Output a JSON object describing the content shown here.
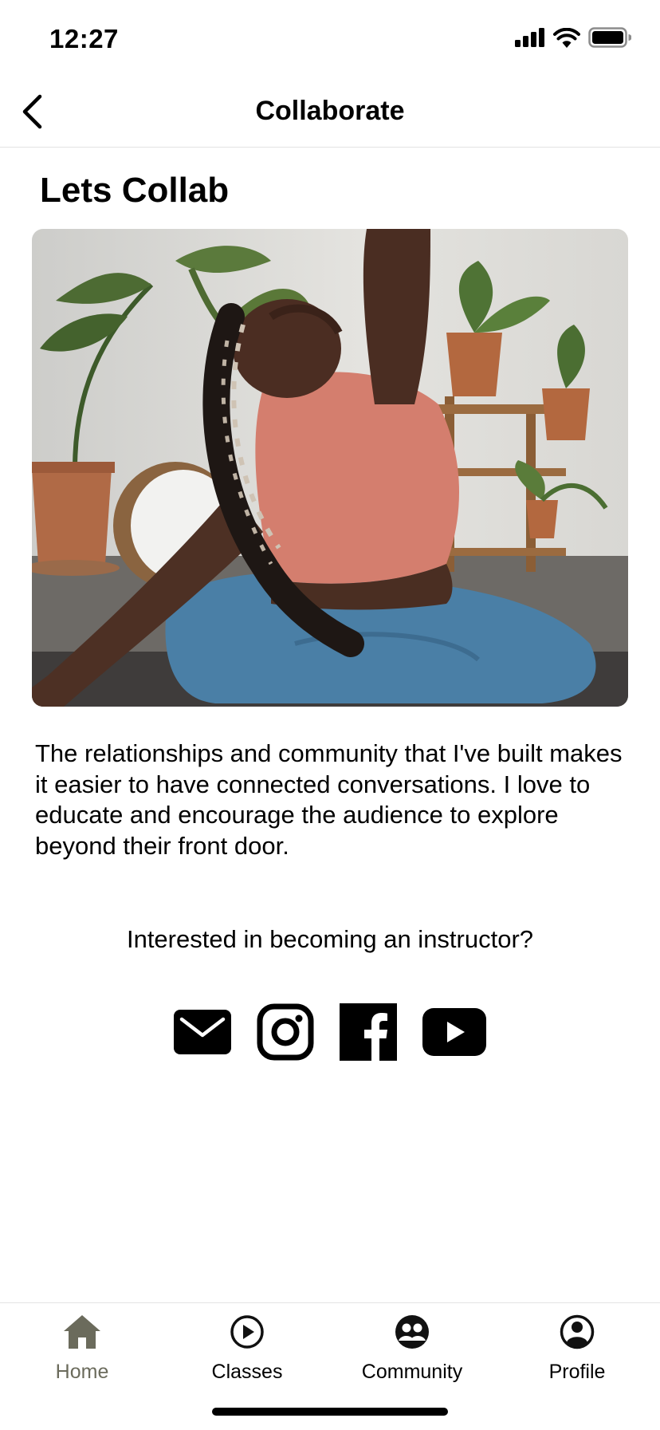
{
  "status_bar": {
    "time": "12:27"
  },
  "nav": {
    "title": "Collaborate"
  },
  "page": {
    "heading": "Lets Collab",
    "description": "The relationships and community that I've built makes it easier to have connected conversations. I love to educate and encourage the audience to explore beyond their front door.",
    "prompt": "Interested in becoming an instructor?"
  },
  "social": [
    {
      "icon": "mail-icon"
    },
    {
      "icon": "instagram-icon"
    },
    {
      "icon": "facebook-icon"
    },
    {
      "icon": "youtube-icon"
    }
  ],
  "tabs": [
    {
      "label": "Home",
      "icon": "home-icon",
      "active": true
    },
    {
      "label": "Classes",
      "icon": "play-circle-icon",
      "active": false
    },
    {
      "label": "Community",
      "icon": "community-icon",
      "active": false
    },
    {
      "label": "Profile",
      "icon": "profile-icon",
      "active": false
    }
  ],
  "colors": {
    "tab_active": "#6b6b5c",
    "tab_inactive": "#111111",
    "text": "#000000"
  }
}
